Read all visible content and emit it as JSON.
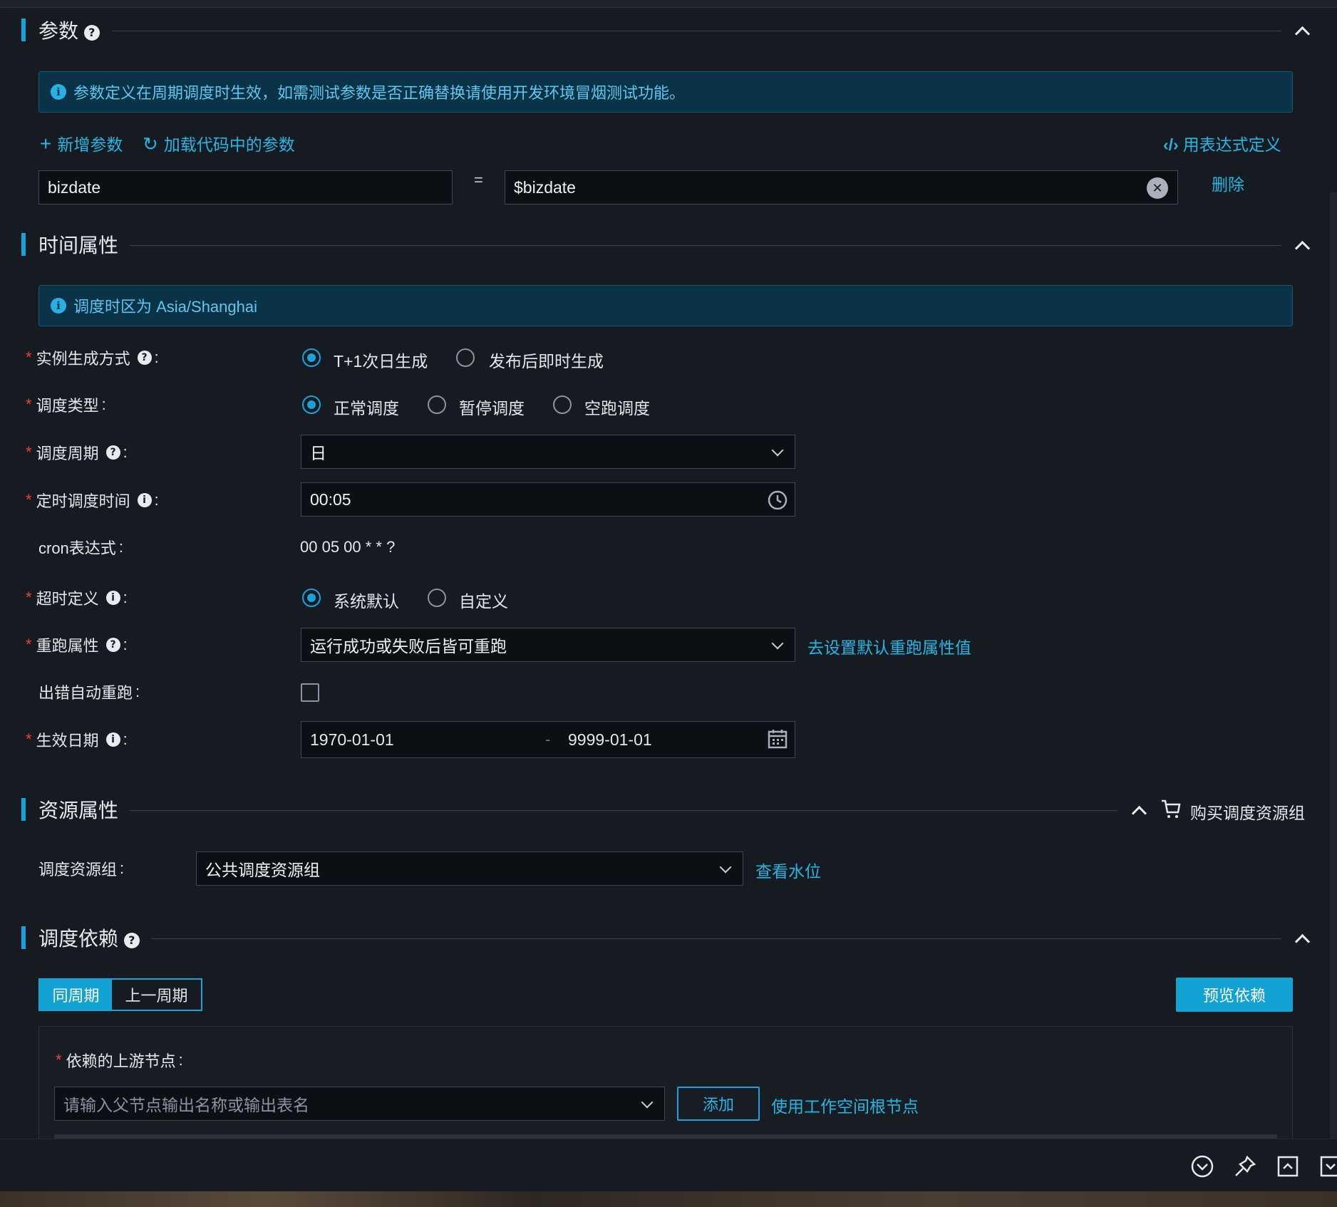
{
  "params": {
    "title": "参数",
    "notice": "参数定义在周期调度时生效，如需测试参数是否正确替换请使用开发环境冒烟测试功能。",
    "add_label": "新增参数",
    "load_label": "加载代码中的参数",
    "expr_label": "用表达式定义",
    "row": {
      "key": "bizdate",
      "equals": "=",
      "value": "$bizdate",
      "delete_label": "删除"
    }
  },
  "time": {
    "title": "时间属性",
    "notice": "调度时区为 Asia/Shanghai",
    "instance_mode": {
      "label": "实例生成方式",
      "options": [
        "T+1次日生成",
        "发布后即时生成"
      ],
      "selected": "T+1次日生成"
    },
    "schedule_type": {
      "label": "调度类型",
      "options": [
        "正常调度",
        "暂停调度",
        "空跑调度"
      ],
      "selected": "正常调度"
    },
    "cycle": {
      "label": "调度周期",
      "value": "日"
    },
    "schedule_time": {
      "label": "定时调度时间",
      "value": "00:05"
    },
    "cron": {
      "label": "cron表达式",
      "value": "00 05 00 * * ?"
    },
    "timeout": {
      "label": "超时定义",
      "options": [
        "系统默认",
        "自定义"
      ],
      "selected": "系统默认"
    },
    "rerun": {
      "label": "重跑属性",
      "value": "运行成功或失败后皆可重跑",
      "link": "去设置默认重跑属性值"
    },
    "auto_rerun": {
      "label": "出错自动重跑",
      "checked": false
    },
    "effective": {
      "label": "生效日期",
      "start": "1970-01-01",
      "sep": "-",
      "end": "9999-01-01"
    }
  },
  "resource": {
    "title": "资源属性",
    "buy_label": "购买调度资源组",
    "group": {
      "label": "调度资源组",
      "value": "公共调度资源组",
      "link": "查看水位"
    }
  },
  "deps": {
    "title": "调度依赖",
    "tabs": [
      "同周期",
      "上一周期"
    ],
    "active_tab": "同周期",
    "preview_label": "预览依赖",
    "upstream": {
      "label": "依赖的上游节点",
      "placeholder": "请输入父节点输出名称或输出表名",
      "add_label": "添加",
      "root_link": "使用工作空间根节点"
    }
  },
  "colors": {
    "accent": "#1aa3d9",
    "link": "#23b7e5",
    "required": "#f04134",
    "background": "#161a21"
  }
}
